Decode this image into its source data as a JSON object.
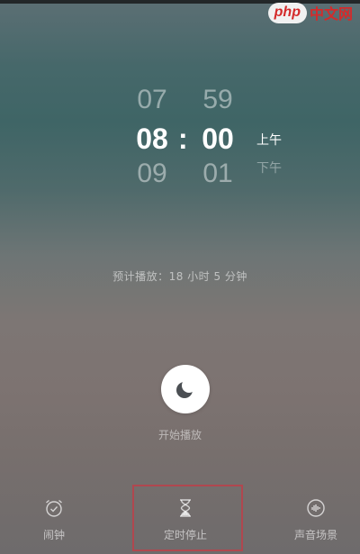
{
  "watermark": {
    "badge": "php",
    "text": "中文网"
  },
  "picker": {
    "hours": {
      "prev": "07",
      "selected": "08",
      "next": "09"
    },
    "separator": ":",
    "minutes": {
      "prev": "59",
      "selected": "00",
      "next": "01"
    },
    "period": {
      "selected": "上午",
      "next": "下午"
    }
  },
  "eta_text": "预计播放：18 小时 5 分钟",
  "start_label": "开始播放",
  "nav": {
    "alarm": "闹钟",
    "timer_stop": "定时停止",
    "ambient": "声音场景"
  },
  "colors": {
    "highlight_border": "#b0474f",
    "watermark_red": "#d42b2b"
  },
  "icons": {
    "start": "moon-icon",
    "alarm": "alarm-clock-icon",
    "timer_stop": "hourglass-icon",
    "ambient": "sound-wave-icon"
  }
}
